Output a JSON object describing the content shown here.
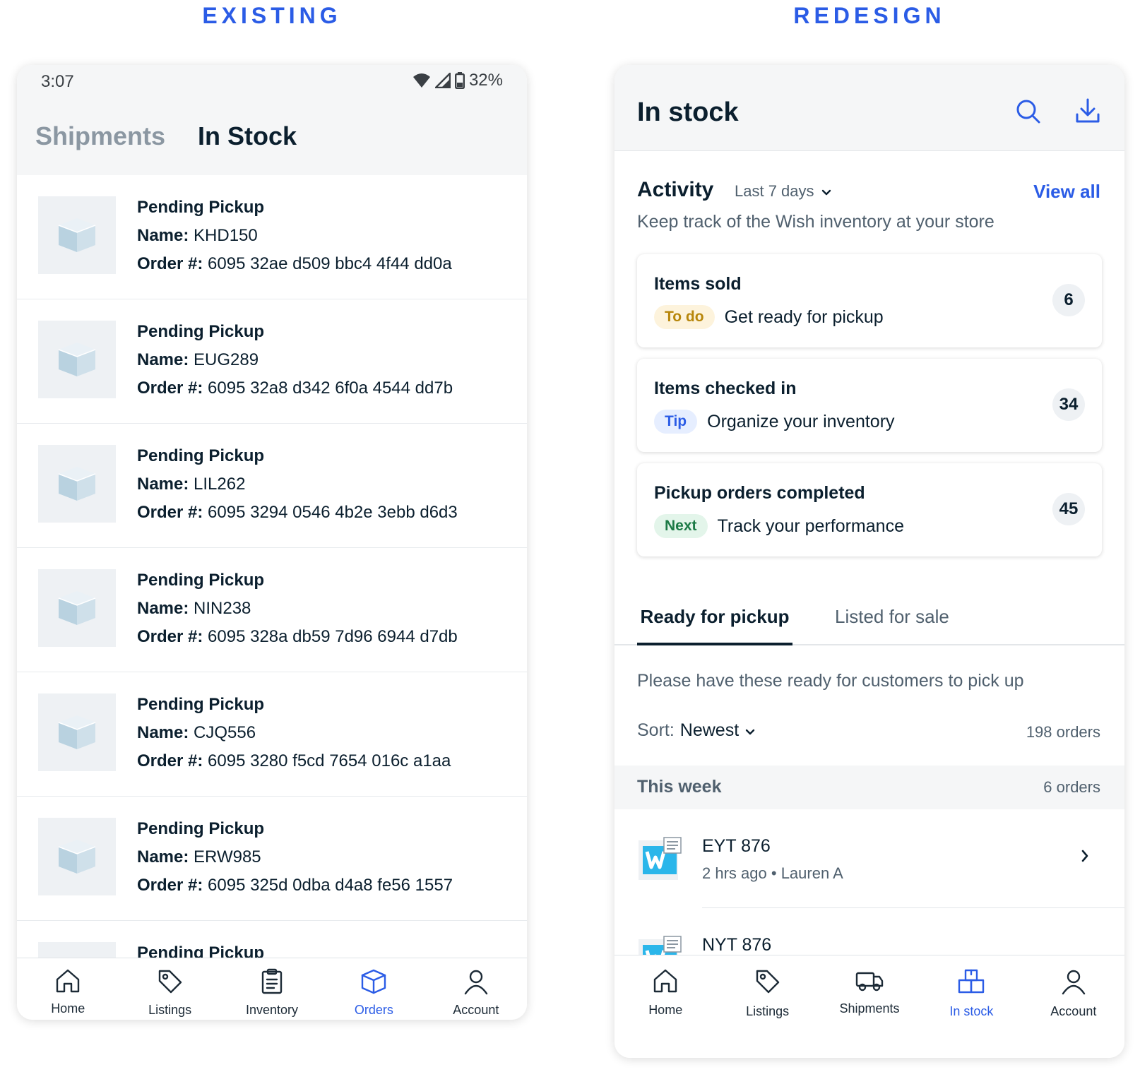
{
  "headings": {
    "left": "EXISTING",
    "right": "REDESIGN"
  },
  "existing": {
    "status_bar": {
      "time": "3:07",
      "battery": "32%"
    },
    "tabs": [
      "Shipments",
      "In Stock"
    ],
    "active_tab": "In Stock",
    "labels": {
      "name": "Name:",
      "order": "Order #:"
    },
    "orders": [
      {
        "status": "Pending Pickup",
        "name": "KHD150",
        "order": "6095 32ae d509 bbc4 4f44 dd0a"
      },
      {
        "status": "Pending Pickup",
        "name": "EUG289",
        "order": "6095 32a8 d342 6f0a 4544 dd7b"
      },
      {
        "status": "Pending Pickup",
        "name": "LIL262",
        "order": "6095 3294 0546 4b2e 3ebb d6d3"
      },
      {
        "status": "Pending Pickup",
        "name": "NIN238",
        "order": "6095 328a db59 7d96 6944 d7db"
      },
      {
        "status": "Pending Pickup",
        "name": "CJQ556",
        "order": "6095 3280 f5cd 7654 016c a1aa"
      },
      {
        "status": "Pending Pickup",
        "name": "ERW985",
        "order": "6095 325d 0dba d4a8 fe56 1557"
      },
      {
        "status": "Pending Pickup",
        "name": "",
        "order": ""
      }
    ],
    "nav": [
      {
        "label": "Home",
        "icon": "home-icon"
      },
      {
        "label": "Listings",
        "icon": "tag-icon"
      },
      {
        "label": "Inventory",
        "icon": "clipboard-icon"
      },
      {
        "label": "Orders",
        "icon": "box-icon",
        "active": true
      },
      {
        "label": "Account",
        "icon": "user-icon"
      }
    ]
  },
  "redesign": {
    "title": "In stock",
    "activity": {
      "title": "Activity",
      "range": "Last 7 days",
      "view_all": "View all",
      "description": "Keep track of the Wish inventory at your store",
      "cards": [
        {
          "title": "Items sold",
          "tag": "To do",
          "text": "Get ready for pickup",
          "count": "6"
        },
        {
          "title": "Items checked in",
          "tag": "Tip",
          "text": "Organize your inventory",
          "count": "34"
        },
        {
          "title": "Pickup orders completed",
          "tag": "Next",
          "text": "Track your performance",
          "count": "45"
        }
      ]
    },
    "tabs": [
      "Ready for pickup",
      "Listed for sale"
    ],
    "active_tab": "Ready for pickup",
    "ready_description": "Please have these ready for customers to pick up",
    "sort": {
      "label": "Sort:",
      "value": "Newest"
    },
    "total_orders": "198 orders",
    "section": {
      "title": "This week",
      "count": "6 orders"
    },
    "orders": [
      {
        "id": "EYT 876",
        "time": "2 hrs ago",
        "separator": "•",
        "customer": "Lauren A"
      },
      {
        "id": "NYT 876",
        "time": "",
        "separator": "",
        "customer": ""
      }
    ],
    "nav": [
      {
        "label": "Home",
        "icon": "home-icon"
      },
      {
        "label": "Listings",
        "icon": "tag-icon"
      },
      {
        "label": "Shipments",
        "icon": "truck-icon"
      },
      {
        "label": "In stock",
        "icon": "stock-boxes-icon",
        "active": true
      },
      {
        "label": "Account",
        "icon": "user-icon"
      }
    ],
    "colors": {
      "accent": "#2b5ce6",
      "todo": "#b7860b",
      "tip": "#2b5ce6",
      "next": "#1c7a46"
    }
  }
}
